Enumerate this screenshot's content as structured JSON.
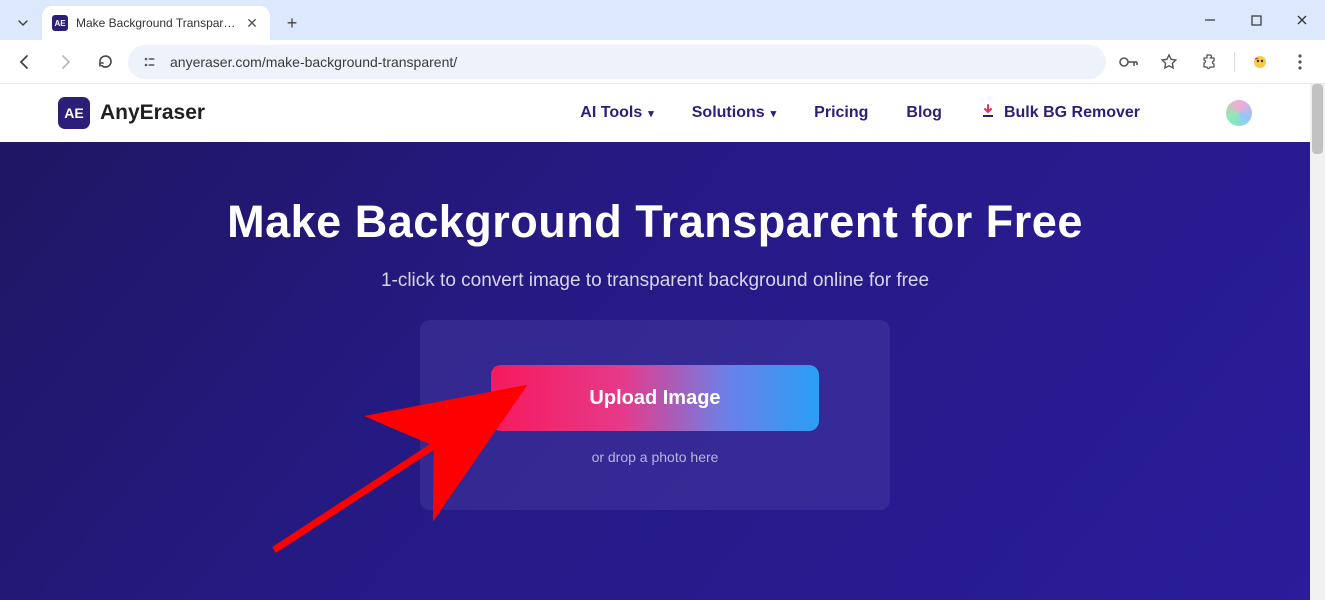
{
  "browser": {
    "tab_title": "Make Background Transparent",
    "tab_favicon_text": "AE",
    "url": "anyeraser.com/make-background-transparent/"
  },
  "header": {
    "logo_badge": "AE",
    "logo_text": "AnyEraser",
    "nav": {
      "ai_tools": "AI Tools",
      "solutions": "Solutions",
      "pricing": "Pricing",
      "blog": "Blog",
      "bulk": "Bulk BG Remover"
    }
  },
  "hero": {
    "title": "Make Background Transparent for Free",
    "subtitle": "1-click to convert image to transparent background online for free",
    "upload_label": "Upload Image",
    "drop_hint": "or drop a photo here"
  }
}
